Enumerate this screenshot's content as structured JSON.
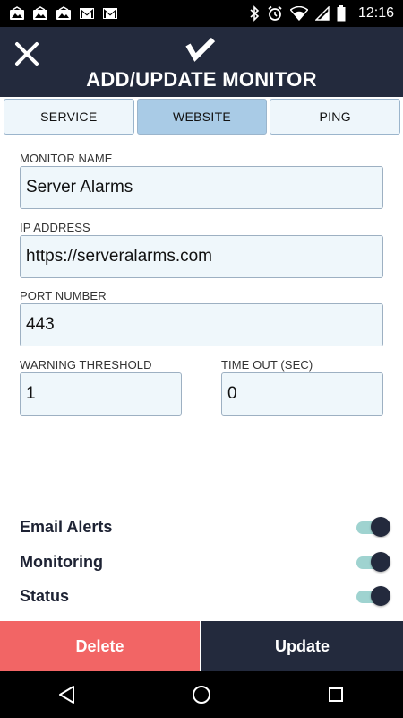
{
  "status_bar": {
    "time": "12:16",
    "left_icons": [
      "image-notification-icon",
      "image-notification-icon",
      "image-notification-icon",
      "gmail-icon",
      "gmail-icon"
    ],
    "right_icons": [
      "bluetooth-icon",
      "alarm-icon",
      "wifi-icon",
      "signal-icon",
      "battery-icon"
    ]
  },
  "app_bar": {
    "title": "ADD/UPDATE MONITOR",
    "close_icon": "close-icon",
    "confirm_icon": "checkmark-icon",
    "background": "#232a3d"
  },
  "tabs": [
    {
      "label": "SERVICE",
      "active": false
    },
    {
      "label": "WEBSITE",
      "active": true
    },
    {
      "label": "PING",
      "active": false
    }
  ],
  "form": {
    "monitor_name": {
      "label": "MONITOR NAME",
      "value": "Server Alarms"
    },
    "ip_address": {
      "label": "IP ADDRESS",
      "value": "https://serveralarms.com"
    },
    "port_number": {
      "label": "PORT NUMBER",
      "value": "443"
    },
    "warning_threshold": {
      "label": "WARNING THRESHOLD",
      "value": "1"
    },
    "time_out": {
      "label": "TIME OUT (SEC)",
      "value": "0"
    }
  },
  "toggles": [
    {
      "label": "Email Alerts",
      "on": true
    },
    {
      "label": "Monitoring",
      "on": true
    },
    {
      "label": "Status",
      "on": true
    }
  ],
  "buttons": {
    "delete_label": "Delete",
    "update_label": "Update",
    "delete_color": "#f26565",
    "update_color": "#232a3d"
  },
  "nav_bar": {
    "icons": [
      "back-icon",
      "home-icon",
      "recents-icon"
    ]
  }
}
